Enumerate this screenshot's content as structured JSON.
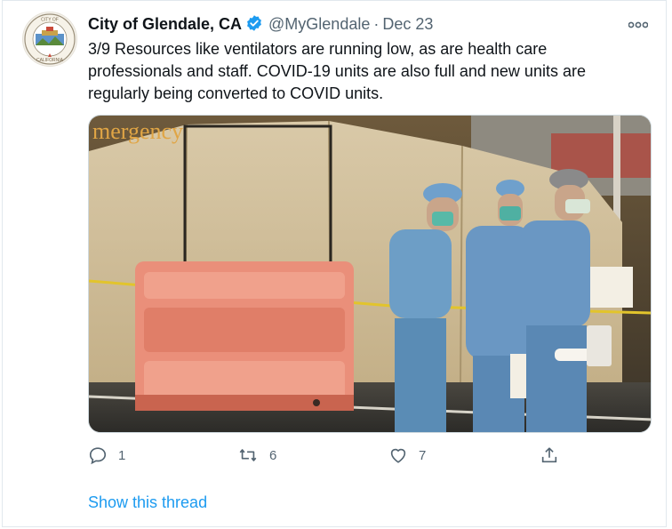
{
  "tweet": {
    "author_name": "City of Glendale, CA",
    "handle": "@MyGlendale",
    "separator": "·",
    "date": "Dec 23",
    "text": "3/9 Resources like ventilators are running low, as are health care professionals and staff. COVID-19 units are also full and new units are regularly being converted to COVID units.",
    "actions": {
      "replies": "1",
      "retweets": "6",
      "likes": "7"
    },
    "show_thread": "Show this thread",
    "media_sign": "mergency",
    "avatar_ring_text": "CITY OF GLENDALE CALIFORNIA"
  },
  "icons": {
    "verified": "verified-badge-icon",
    "more": "more-dots-icon",
    "reply": "reply-icon",
    "retweet": "retweet-icon",
    "like": "heart-icon",
    "share": "share-icon"
  },
  "colors": {
    "accent": "#1d9bf0",
    "text": "#0f1419",
    "secondary": "#536471",
    "border": "#e1e8ed"
  }
}
